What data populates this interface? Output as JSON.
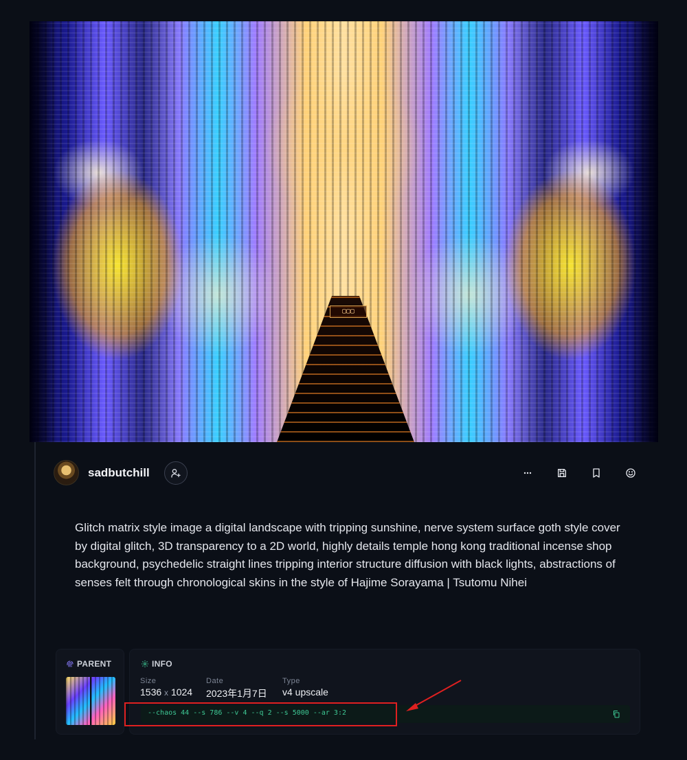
{
  "post": {
    "image_alt": "Generated artwork",
    "author": {
      "username": "sadbutchill"
    },
    "prompt": "Glitch matrix style image a digital landscape with tripping sunshine, nerve system surface goth style cover by digital glitch, 3D transparency to a 2D world, highly details temple hong kong traditional incense shop background, psychedelic straight lines tripping interior structure diffusion with black lights, abstractions of senses felt through chronological skins in the style of Hajime Sorayama | Tsutomu Nihei",
    "actions": [
      "more-options",
      "save",
      "bookmark",
      "react"
    ]
  },
  "parent": {
    "label": "PARENT"
  },
  "info": {
    "label": "INFO",
    "size_label": "Size",
    "size_w": "1536",
    "size_x": "x",
    "size_h": "1024",
    "date_label": "Date",
    "date_value": "2023年1月7日",
    "type_label": "Type",
    "type_value": "v4 upscale",
    "params": "--chaos 44 --s 786 --v 4 --q 2 --s 5000 --ar 3:2"
  },
  "colors": {
    "background": "#0b0f17",
    "panel": "#10141d",
    "params_text": "#3ec995",
    "info_icon": "#3ec995",
    "parent_icon": "#8a7cff",
    "annotation": "#e02020"
  }
}
